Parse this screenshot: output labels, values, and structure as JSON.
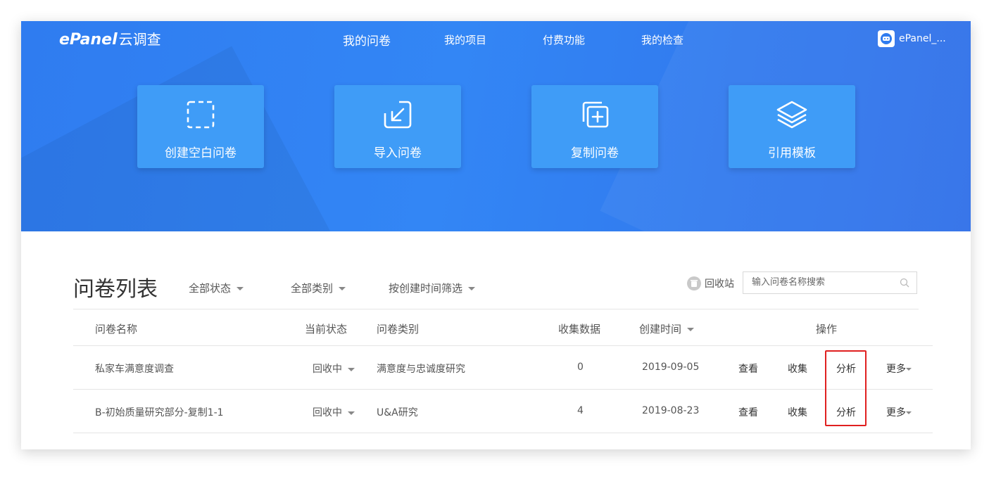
{
  "header": {
    "logo_brand": "ePanel",
    "logo_suffix": "云调查",
    "nav": [
      "我的问卷",
      "我的项目",
      "付费功能",
      "我的检查"
    ],
    "user_name": "ePanel_..."
  },
  "actions": [
    {
      "label": "创建空白问卷",
      "icon": "dashed-square-icon"
    },
    {
      "label": "导入问卷",
      "icon": "import-arrow-icon"
    },
    {
      "label": "复制问卷",
      "icon": "copy-plus-icon"
    },
    {
      "label": "引用模板",
      "icon": "layers-icon"
    }
  ],
  "list": {
    "title": "问卷列表",
    "filters": [
      "全部状态",
      "全部类别",
      "按创建时间筛选"
    ],
    "recycle_label": "回收站",
    "search_placeholder": "输入问卷名称搜索",
    "columns": [
      "问卷名称",
      "当前状态",
      "问卷类别",
      "收集数据",
      "创建时间",
      "操作"
    ],
    "rows": [
      {
        "name": "私家车满意度调查",
        "status": "回收中",
        "category": "满意度与忠诚度研究",
        "count": "0",
        "created": "2019-09-05",
        "ops": [
          "查看",
          "收集",
          "分析",
          "更多"
        ]
      },
      {
        "name": "B-初始质量研究部分-复制1-1",
        "status": "回收中",
        "category": "U&A研究",
        "count": "4",
        "created": "2019-08-23",
        "ops": [
          "查看",
          "收集",
          "分析",
          "更多"
        ]
      }
    ]
  },
  "colors": {
    "hero": "#3386f5",
    "card": "#3f9cf7",
    "highlight": "#e02020"
  }
}
